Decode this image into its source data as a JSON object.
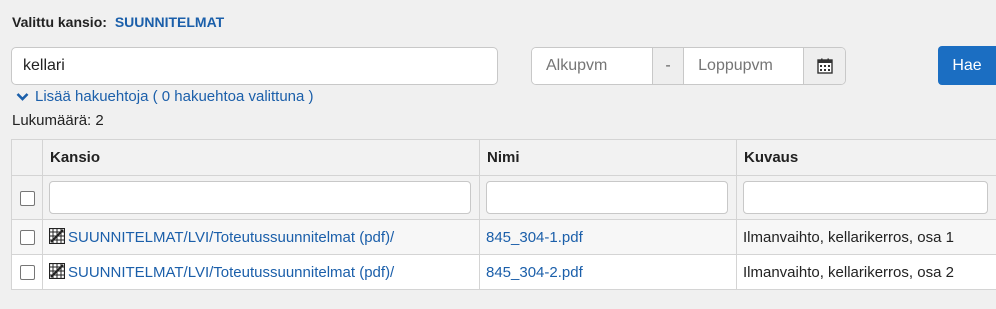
{
  "folder": {
    "label": "Valittu kansio:",
    "value": "SUUNNITELMAT"
  },
  "search": {
    "value": "kellari"
  },
  "dates": {
    "start_placeholder": "Alkupvm",
    "separator": "-",
    "end_placeholder": "Loppupvm"
  },
  "search_button": "Hae",
  "more_criteria": "Lisää hakuehtoja ( 0 hakuehtoa valittuna )",
  "count_text": "Lukumäärä: 2",
  "table": {
    "columns": [
      "Kansio",
      "Nimi",
      "Kuvaus"
    ],
    "rows": [
      {
        "folder": "SUUNNITELMAT/LVI/Toteutussuunnitelmat (pdf)/",
        "name": "845_304-1.pdf",
        "description": "Ilmanvaihto, kellarikerros, osa 1"
      },
      {
        "folder": "SUUNNITELMAT/LVI/Toteutussuunnitelmat (pdf)/",
        "name": "845_304-2.pdf",
        "description": "Ilmanvaihto, kellarikerros, osa 2"
      }
    ]
  },
  "colors": {
    "accent": "#1b6ec2",
    "link": "#1b5faa"
  },
  "icons": {
    "calendar": "calendar-icon",
    "chevron": "chevron-down-icon",
    "folder": "folder-grid-icon"
  }
}
